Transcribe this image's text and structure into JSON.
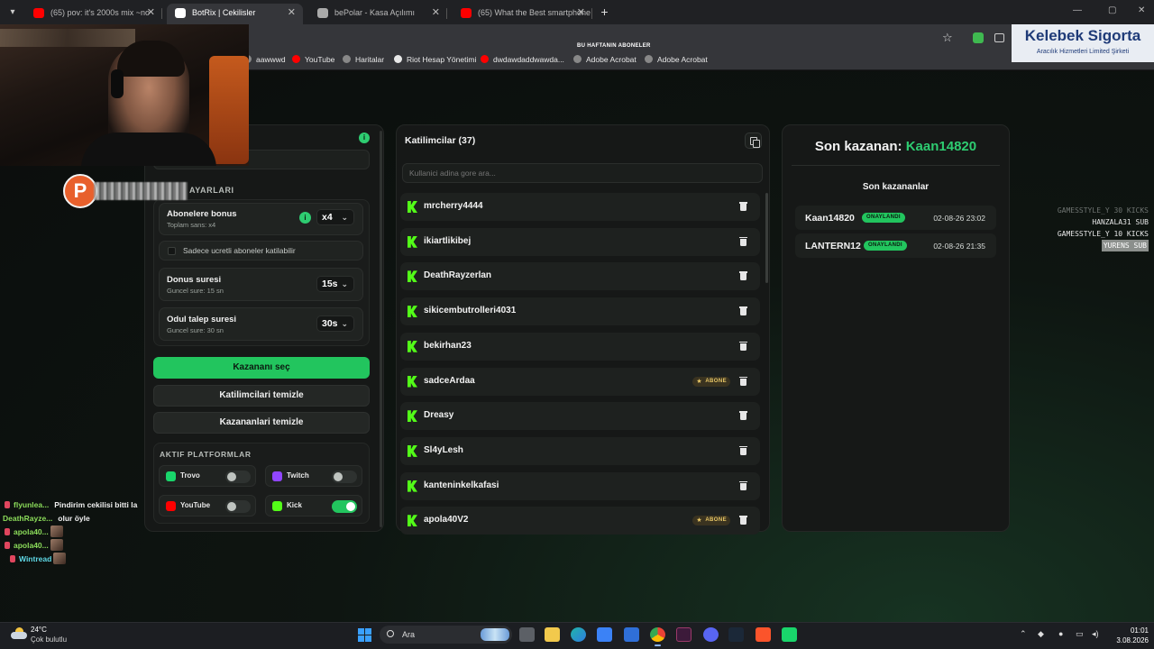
{
  "browser": {
    "tabs": [
      {
        "label": "(65) pov: it's 2000s mix ~no",
        "icon": "youtube-icon",
        "color": "#ff0000",
        "active": false
      },
      {
        "label": "BotRix | Cekilisler",
        "icon": "botrix-icon",
        "color": "#ffffff",
        "active": true
      },
      {
        "label": "bePolar - Kasa Açılımı",
        "icon": "globe-icon",
        "color": "#aaaaaa",
        "active": false
      },
      {
        "label": "(65) What the Best smartphone",
        "icon": "youtube-icon",
        "color": "#ff0000",
        "active": false
      }
    ],
    "bookmarks": [
      {
        "label": "aawwwd",
        "color": "#888888"
      },
      {
        "label": "YouTube",
        "color": "#ff0000"
      },
      {
        "label": "Haritalar",
        "color": "#888888"
      },
      {
        "label": "Riot Hesap Yönetimi",
        "color": "#e8e8e8"
      },
      {
        "label": "dwdawdaddwawda...",
        "color": "#ff0000"
      },
      {
        "label": "Adobe Acrobat",
        "color": "#888888"
      },
      {
        "label": "Adobe Acrobat",
        "color": "#888888"
      }
    ]
  },
  "overlay": {
    "ticker": "BU HAFTANIN ABONELER",
    "sponsor_name": "Kelebek Sigorta",
    "sponsor_sub": "Aracılık Hizmetleri Limited Şirketi",
    "events": [
      "GAMESSTYLE_Y 30 KICKS",
      "HANZALA31 SUB",
      "GAMESSTYLE_Y 10 KICKS",
      "YURENS SUB"
    ],
    "chat": [
      {
        "user": "flyunlea...",
        "msg": "Pindirim cekilisi bitti la"
      },
      {
        "user": "DeathRayze...",
        "msg": "olur öyle"
      },
      {
        "user": "apola40...",
        "msg": ""
      },
      {
        "user": "apola40...",
        "msg": ""
      },
      {
        "user": "Wintread",
        "msg": ""
      }
    ]
  },
  "settings": {
    "section_title": "AYARLARI",
    "sub_bonus": {
      "title": "Abonelere bonus",
      "subtitle": "Toplam sans: x4",
      "value": "x4"
    },
    "paid_only_label": "Sadece ucretli aboneler katilabilir",
    "bonus_duration": {
      "title": "Donus suresi",
      "subtitle": "Guncel sure: 15 sn",
      "value": "15s"
    },
    "claim_duration": {
      "title": "Odul talep suresi",
      "subtitle": "Guncel sure: 30 sn",
      "value": "30s"
    },
    "pick_winner": "Kazananı seç",
    "clear_participants": "Katilimcilari temizle",
    "clear_winners": "Kazananlari temizle",
    "platforms_title": "AKTIF PLATFORMLAR",
    "platforms": [
      {
        "name": "Trovo",
        "on": false,
        "color": "#19d66b"
      },
      {
        "name": "Twitch",
        "on": false,
        "color": "#9146ff"
      },
      {
        "name": "YouTube",
        "on": false,
        "color": "#ff0000"
      },
      {
        "name": "Kick",
        "on": true,
        "color": "#53fc18"
      }
    ]
  },
  "participants": {
    "title": "Katilimcilar (37)",
    "search_placeholder": "Kullanici adina gore ara...",
    "badge_label": "ABONE",
    "list": [
      {
        "name": "mrcherry4444",
        "sub": false
      },
      {
        "name": "ikiartlikibej",
        "sub": false
      },
      {
        "name": "DeathRayzerlan",
        "sub": false
      },
      {
        "name": "sikicembutrolleri4031",
        "sub": false
      },
      {
        "name": "bekirhan23",
        "sub": false
      },
      {
        "name": "sadceArdaa",
        "sub": true
      },
      {
        "name": "Dreasy",
        "sub": false
      },
      {
        "name": "Sl4yLesh",
        "sub": false
      },
      {
        "name": "kanteninkelkafasi",
        "sub": false
      },
      {
        "name": "apola40V2",
        "sub": true
      }
    ]
  },
  "winners": {
    "last_label": "Son kazanan:",
    "last_name": "Kaan14820",
    "list_title": "Son kazananlar",
    "status_label": "ONAYLANDI",
    "list": [
      {
        "name": "Kaan14820",
        "date": "02-08-26 23:02"
      },
      {
        "name": "LANTERN12",
        "date": "02-08-26 21:35"
      }
    ]
  },
  "taskbar": {
    "temp": "24°C",
    "weather": "Çok bulutlu",
    "search": "Ara",
    "time": "01:01",
    "date": "3.08.2026"
  }
}
